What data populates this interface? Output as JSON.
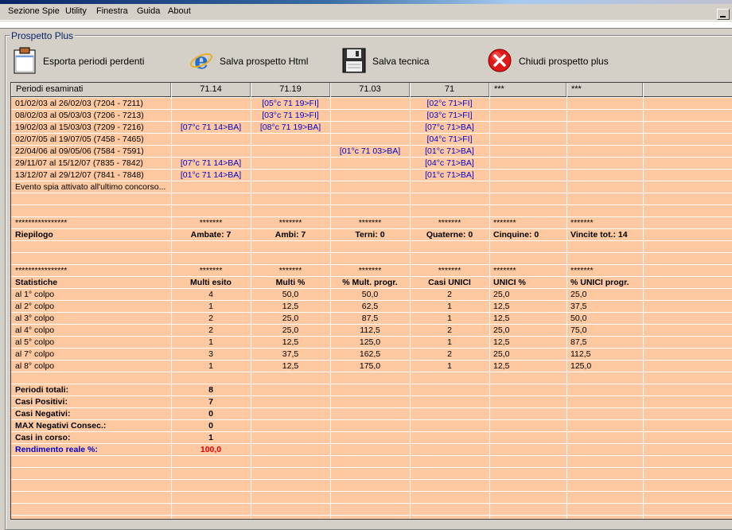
{
  "menu": [
    "Sezione Spie",
    "Utility",
    "Finestra",
    "Guida",
    "About"
  ],
  "frame_title": "Prospetto Plus",
  "toolbar": {
    "export": "Esporta periodi perdenti",
    "save_html": "Salva prospetto Html",
    "save_tech": "Salva tecnica",
    "close": "Chiudi prospetto plus"
  },
  "headers": [
    "Periodi esaminati",
    "71.14",
    "71.19",
    "71.03",
    "71",
    "***",
    "***"
  ],
  "rows": [
    [
      "01/02/03 al 26/02/03  (7204 - 7211)",
      "",
      "[05°c 71 19>FI]",
      "",
      "[02°c 71>FI]",
      "",
      ""
    ],
    [
      "08/02/03 al 05/03/03  (7206 - 7213)",
      "",
      "[03°c 71 19>FI]",
      "",
      "[03°c 71>FI]",
      "",
      ""
    ],
    [
      "19/02/03 al 15/03/03  (7209 - 7216)",
      "[07°c 71 14>BA]",
      "[08°c 71 19>BA]",
      "",
      "[07°c 71>BA]",
      "",
      ""
    ],
    [
      "02/07/05 al 19/07/05  (7458 - 7465)",
      "",
      "",
      "",
      "[04°c 71>FI]",
      "",
      ""
    ],
    [
      "22/04/06 al 09/05/06  (7584 - 7591)",
      "",
      "",
      "[01°c 71 03>BA]",
      "[01°c 71>BA]",
      "",
      ""
    ],
    [
      "29/11/07 al 15/12/07  (7835 - 7842)",
      "[07°c 71 14>BA]",
      "",
      "",
      "[04°c 71>BA]",
      "",
      ""
    ],
    [
      "13/12/07 al 29/12/07  (7841 - 7848)",
      "[01°c 71 14>BA]",
      "",
      "",
      "[01°c 71>BA]",
      "",
      ""
    ],
    [
      "Evento spia attivato all'ultimo concorso...",
      "",
      "",
      "",
      "",
      "",
      ""
    ],
    [
      "",
      "",
      "",
      "",
      "",
      "",
      ""
    ],
    [
      "",
      "",
      "",
      "",
      "",
      "",
      ""
    ],
    [
      "****************",
      "*******",
      "*******",
      "*******",
      "*******",
      "*******",
      "*******"
    ],
    [
      "Riepilogo",
      "Ambate: 7",
      "Ambi: 7",
      "Terni: 0",
      "Quaterne: 0",
      "Cinquine: 0",
      "Vincite tot.: 14"
    ],
    [
      "",
      "",
      "",
      "",
      "",
      "",
      ""
    ],
    [
      "",
      "",
      "",
      "",
      "",
      "",
      ""
    ],
    [
      "****************",
      "*******",
      "*******",
      "*******",
      "*******",
      "*******",
      "*******"
    ],
    [
      "Statistiche",
      "Multi esito",
      "Multi %",
      "% Mult. progr.",
      "Casi UNICI",
      "UNICI %",
      "% UNICI progr."
    ],
    [
      "al 1° colpo",
      "4",
      "50,0",
      "50,0",
      "2",
      "25,0",
      "25,0"
    ],
    [
      "al 2° colpo",
      "1",
      "12,5",
      "62,5",
      "1",
      "12,5",
      "37,5"
    ],
    [
      "al 3° colpo",
      "2",
      "25,0",
      "87,5",
      "1",
      "12,5",
      "50,0"
    ],
    [
      "al 4° colpo",
      "2",
      "25,0",
      "112,5",
      "2",
      "25,0",
      "75,0"
    ],
    [
      "al 5° colpo",
      "1",
      "12,5",
      "125,0",
      "1",
      "12,5",
      "87,5"
    ],
    [
      "al 7° colpo",
      "3",
      "37,5",
      "162,5",
      "2",
      "25,0",
      "112,5"
    ],
    [
      "al 8° colpo",
      "1",
      "12,5",
      "175,0",
      "1",
      "12,5",
      "125,0"
    ],
    [
      "",
      "",
      "",
      "",
      "",
      "",
      ""
    ],
    [
      "Periodi totali:",
      "8",
      "",
      "",
      "",
      "",
      ""
    ],
    [
      "Casi Positivi:",
      "7",
      "",
      "",
      "",
      "",
      ""
    ],
    [
      "Casi Negativi:",
      "0",
      "",
      "",
      "",
      "",
      ""
    ],
    [
      "MAX Negativi Consec.:",
      "0",
      "",
      "",
      "",
      "",
      ""
    ],
    [
      "Casi in corso:",
      "1",
      "",
      "",
      "",
      "",
      ""
    ],
    [
      "Rendimento reale %:",
      "100,0",
      "",
      "",
      "",
      "",
      ""
    ]
  ],
  "colors": {
    "grid_bg": "#fec9a1",
    "link_blue": "#0000cc",
    "highlight_red": "#e00000"
  }
}
